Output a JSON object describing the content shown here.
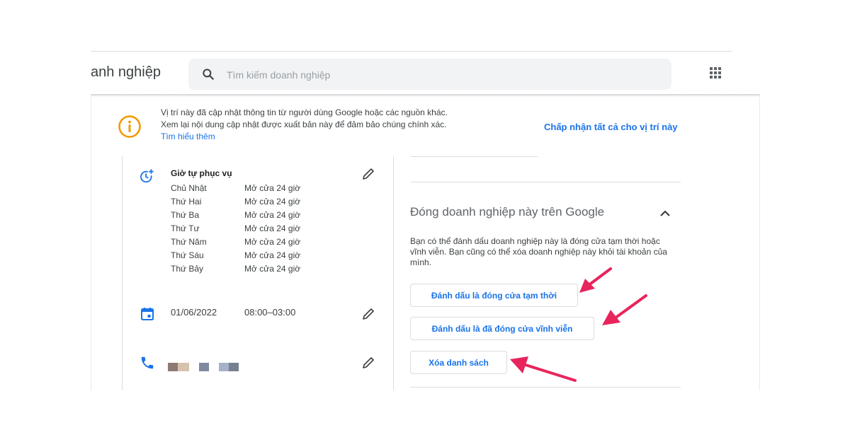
{
  "header": {
    "app_title": "anh nghiệp",
    "search_placeholder": "Tìm kiếm doanh nghiệp",
    "search_icon": "search-icon",
    "apps_icon": "apps-grid-icon"
  },
  "notice": {
    "line1": "Vị trí này đã cập nhật thông tin từ người dùng Google hoặc các nguồn khác.",
    "line2": "Xem lại nội dung cập nhật được xuất bản này để đảm bảo chúng chính xác.",
    "learn_more": "Tìm hiểu thêm",
    "accept_all": "Chấp nhận tất cả cho vị trí này",
    "icon": "info-icon",
    "icon_color": "#f29900"
  },
  "hours": {
    "title": "Giờ tự phục vụ",
    "rows": [
      {
        "day": "Chủ Nhật",
        "value": "Mở cửa 24 giờ"
      },
      {
        "day": "Thứ Hai",
        "value": "Mở cửa 24 giờ"
      },
      {
        "day": "Thứ Ba",
        "value": "Mở cửa 24 giờ"
      },
      {
        "day": "Thứ Tư",
        "value": "Mở cửa 24 giờ"
      },
      {
        "day": "Thứ Năm",
        "value": "Mở cửa 24 giờ"
      },
      {
        "day": "Thứ Sáu",
        "value": "Mở cửa 24 giờ"
      },
      {
        "day": "Thứ Bảy",
        "value": "Mở cửa 24 giờ"
      }
    ]
  },
  "special_hours": {
    "date": "01/06/2022",
    "time": "08:00–03:00"
  },
  "phone": {
    "icon": "phone-icon",
    "masked_colors": [
      "#8d7b73",
      "#d6c3ae",
      "#7f8aa1",
      "#a5b2c7",
      "#77808e"
    ]
  },
  "close_section": {
    "title": "Đóng doanh nghiệp này trên Google",
    "description": "Bạn có thể đánh dấu doanh nghiệp này là đóng cửa tạm thời hoặc vĩnh viễn. Bạn cũng có thể xóa doanh nghiệp này khỏi tài khoản của mình.",
    "btn_temp": "Đánh dấu là đóng cửa tạm thời",
    "btn_perm": "Đánh dấu là đã đóng cửa vĩnh viễn",
    "btn_delete": "Xóa danh sách"
  },
  "colors": {
    "accent": "#1a73e8",
    "annotation_arrow": "#e8245c"
  }
}
